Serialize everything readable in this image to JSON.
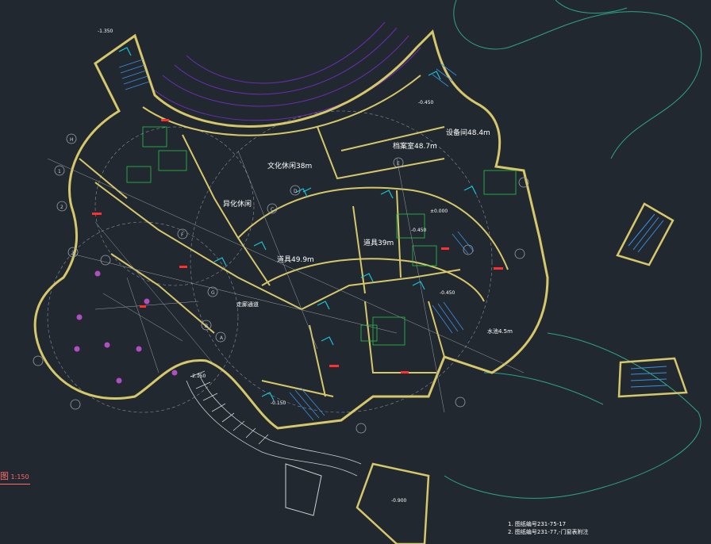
{
  "drawing": {
    "scale_prefix": "图",
    "scale": "1:150",
    "rooms": {
      "hall": "文化休闲38m",
      "archive": "档案室48.7m",
      "storage": "设备间48.4m",
      "office": "异化休闲",
      "lounge": "道具49.9m",
      "library": "道具39m",
      "water": "水池4.5m",
      "corridor": "走廊通道"
    },
    "levels": [
      "-1.350",
      "-0.450",
      "-0.450",
      "±0.000",
      "-2.150",
      "-0.150",
      "-0.450",
      "-0.900"
    ],
    "grid_tags": [
      "A",
      "B",
      "C",
      "D",
      "E",
      "F",
      "G",
      "H",
      "1",
      "2",
      "3"
    ],
    "notes": [
      "1. 图纸编号231-75-17",
      "2. 图纸编号231-77,-门窗表附注"
    ]
  },
  "colors": {
    "background": "#212830",
    "wall": "#d6c86a",
    "purple": "#6a2fb0",
    "cyan": "#18c6d8",
    "green": "#26c24a",
    "magenta": "#b04fc0",
    "red": "#ff3030",
    "teal": "#2fa386"
  }
}
